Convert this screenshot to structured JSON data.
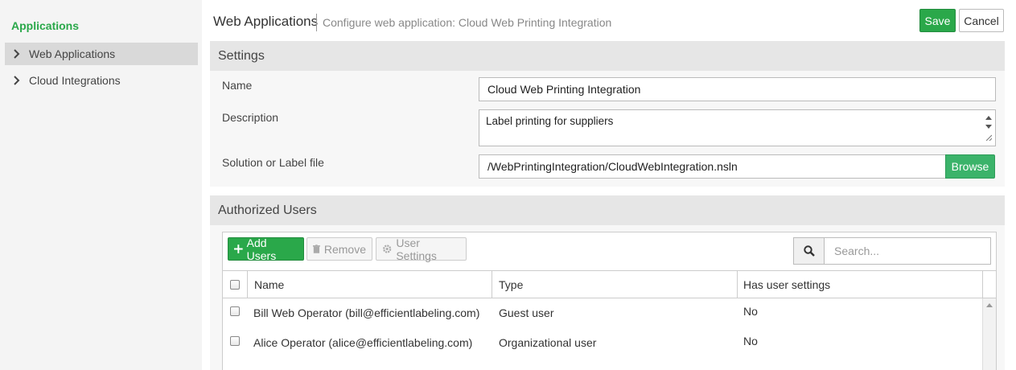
{
  "sidebar": {
    "title": "Applications",
    "items": [
      {
        "label": "Web Applications",
        "icon": "chevron-right-icon"
      },
      {
        "label": "Cloud Integrations",
        "icon": "chevron-right-icon"
      }
    ]
  },
  "header": {
    "title": "Web Applications",
    "subtitle": "Configure web application: Cloud Web Printing Integration",
    "save_label": "Save",
    "cancel_label": "Cancel"
  },
  "settings": {
    "section_title": "Settings",
    "name_label": "Name",
    "name_value": "Cloud Web Printing Integration",
    "description_label": "Description",
    "description_value": "Label printing for suppliers",
    "file_label": "Solution or Label file",
    "file_value": "/WebPrintingIntegration/CloudWebIntegration.nsln",
    "browse_label": "Browse"
  },
  "users": {
    "section_title": "Authorized Users",
    "add_label": "Add Users",
    "remove_label": "Remove",
    "settings_label": "User Settings",
    "search_placeholder": "Search...",
    "columns": [
      "Name",
      "Type",
      "Has user settings"
    ],
    "rows": [
      {
        "name": "Bill Web Operator (bill@efficientlabeling.com)",
        "type": "Guest user",
        "has_settings": "No"
      },
      {
        "name": "Alice Operator (alice@efficientlabeling.com)",
        "type": "Organizational user",
        "has_settings": "No"
      }
    ]
  },
  "colors": {
    "accent_green": "#2aa84a",
    "browse_green": "#3bb36a",
    "sidebar_bg": "#f4f4f4",
    "panel_header_bg": "#e6e6e6"
  }
}
